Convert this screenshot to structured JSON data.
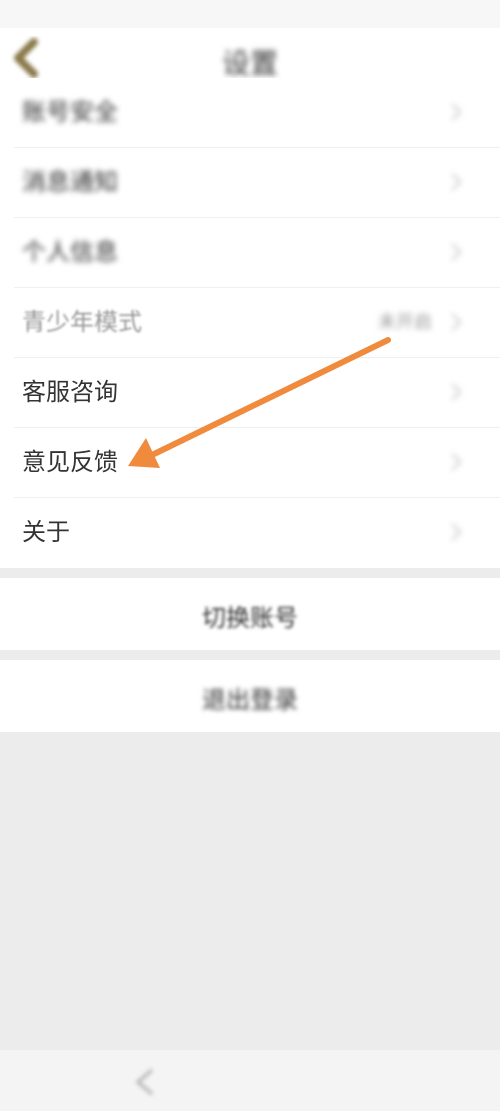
{
  "header": {
    "title": "设置",
    "back_icon": "chevron-left-icon"
  },
  "menu": {
    "items": [
      {
        "label": "账号安全"
      },
      {
        "label": "消息通知"
      },
      {
        "label": "个人信息"
      },
      {
        "label": "青少年模式",
        "value": "未开启"
      },
      {
        "label": "客服咨询"
      },
      {
        "label": "意见反馈"
      },
      {
        "label": "关于"
      }
    ]
  },
  "buttons": {
    "switch_account": "切换账号",
    "logout": "退出登录"
  },
  "colors": {
    "arrow": "#f08a3c",
    "back_icon": "#8a7a4a",
    "background": "#ececec"
  }
}
